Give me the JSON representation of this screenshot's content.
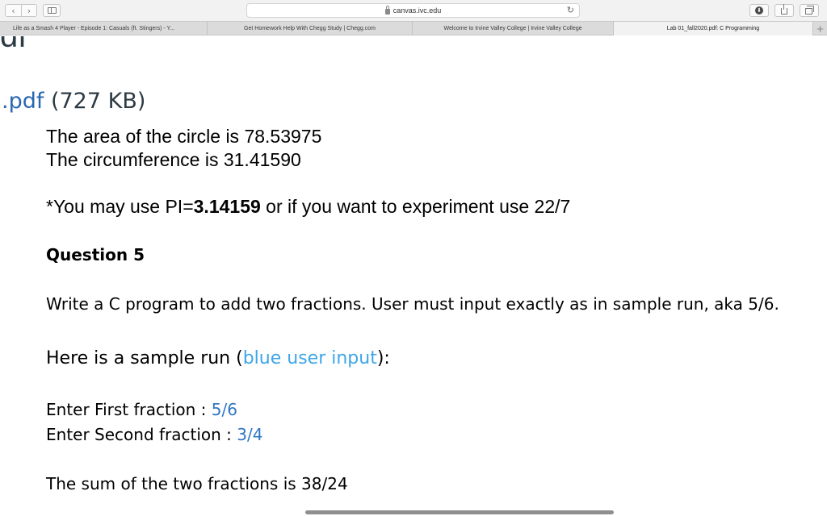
{
  "browser": {
    "back_glyph": "‹",
    "forward_glyph": "›",
    "url": "canvas.ivc.edu",
    "reload_glyph": "↻",
    "download_glyph": "⬇",
    "icons": [
      "back-icon",
      "forward-icon",
      "sidebar-icon",
      "lock-icon",
      "reload-icon",
      "download-icon",
      "share-icon",
      "tabs-overview-icon",
      "new-tab-icon"
    ]
  },
  "tabs": [
    {
      "label": "Life as a Smash 4 Player - Episode 1: Casuals (ft. Stingers) - Y..."
    },
    {
      "label": "Get Homework Help With Chegg Study | Chegg.com"
    },
    {
      "label": "Welcome to Irvine Valley College | Irvine Valley College"
    },
    {
      "label": "Lab 01_fall2020.pdf: C Programming"
    }
  ],
  "new_tab_glyph": "+",
  "page": {
    "cut_heading": "df",
    "file_link": ".pdf",
    "file_size": " (727 KB)"
  },
  "doc": {
    "area_line": "The area of the circle is 78.53975",
    "circ_line": "The circumference is 31.41590",
    "pi_prefix": "*You may use PI=",
    "pi_value": "3.14159",
    "pi_suffix": " or if you want to experiment use 22/7",
    "question_title": "Question 5",
    "write_line": "Write a  C program to add two fractions. User must input exactly as in sample run, aka 5/6.",
    "sample_prefix": "Here is a sample run (",
    "sample_blue": "blue user input",
    "sample_suffix": "):",
    "first_prompt": "Enter First fraction : ",
    "first_input": "5/6",
    "second_prompt": "Enter Second fraction : ",
    "second_input": "3/4",
    "sum_line": "The sum of the two fractions is 38/24"
  },
  "colors": {
    "chrome": "#f3f2f3",
    "tabbar": "#dcdbdc",
    "link": "#2b66b3",
    "user_input": "#2f77c4",
    "legend_blue": "#3ea6e8"
  }
}
